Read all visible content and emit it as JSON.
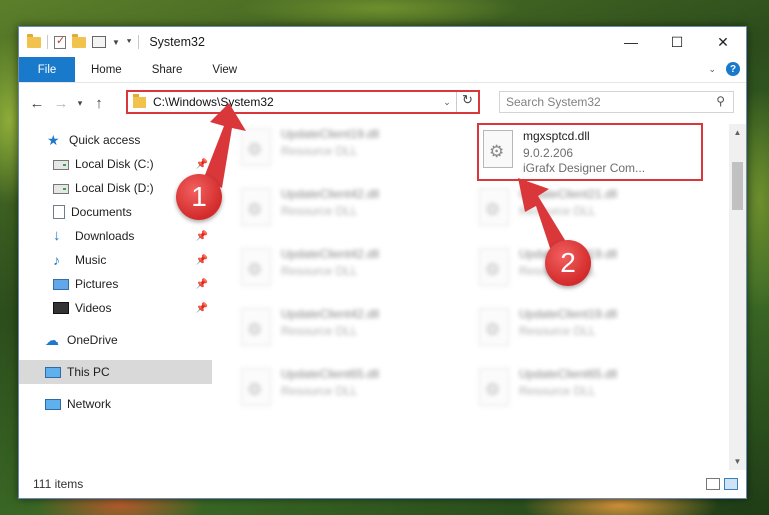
{
  "window": {
    "title": "System32"
  },
  "ribbon": {
    "file": "File",
    "tabs": [
      "Home",
      "Share",
      "View"
    ]
  },
  "address": {
    "path": "C:\\Windows\\System32",
    "search_placeholder": "Search System32"
  },
  "nav": {
    "items": [
      {
        "label": "Quick access",
        "icon": "star-icon",
        "pinned": false
      },
      {
        "label": "Local Disk (C:)",
        "icon": "disk-icon",
        "pinned": true
      },
      {
        "label": "Local Disk (D:)",
        "icon": "disk-icon",
        "pinned": false
      },
      {
        "label": "Documents",
        "icon": "document-icon",
        "pinned": false
      },
      {
        "label": "Downloads",
        "icon": "download-icon",
        "pinned": true
      },
      {
        "label": "Music",
        "icon": "music-icon",
        "pinned": true
      },
      {
        "label": "Pictures",
        "icon": "pictures-icon",
        "pinned": true
      },
      {
        "label": "Videos",
        "icon": "video-icon",
        "pinned": true
      },
      {
        "label": "OneDrive",
        "icon": "onedrive-icon",
        "pinned": false
      },
      {
        "label": "This PC",
        "icon": "this-pc-icon",
        "pinned": false
      },
      {
        "label": "Network",
        "icon": "network-icon",
        "pinned": false
      }
    ]
  },
  "files": {
    "highlighted": {
      "name": "mgxsptcd.dll",
      "version": "9.0.2.206",
      "description": "iGrafx Designer Com..."
    },
    "left_column": [
      {
        "name": "UpdateClient19.dll",
        "type": "Resource DLL"
      },
      {
        "name": "UpdateClient42.dll",
        "type": "Resource DLL"
      },
      {
        "name": "UpdateClient42.dll",
        "type": "Resource DLL"
      },
      {
        "name": "UpdateClient42.dll",
        "type": "Resource DLL"
      },
      {
        "name": "UpdateClient65.dll",
        "type": "Resource DLL"
      }
    ],
    "right_column": [
      {
        "name": "UpdateClient21.dll",
        "type": "Resource DLL"
      },
      {
        "name": "UpdateClient19.dll",
        "type": "Resource DLL"
      },
      {
        "name": "UpdateClient19.dll",
        "type": "Resource DLL"
      },
      {
        "name": "UpdateClient65.dll",
        "type": "Resource DLL"
      }
    ]
  },
  "status": {
    "items": "111 items"
  },
  "annotations": {
    "step1": "1",
    "step2": "2",
    "color": "#d9373a"
  }
}
